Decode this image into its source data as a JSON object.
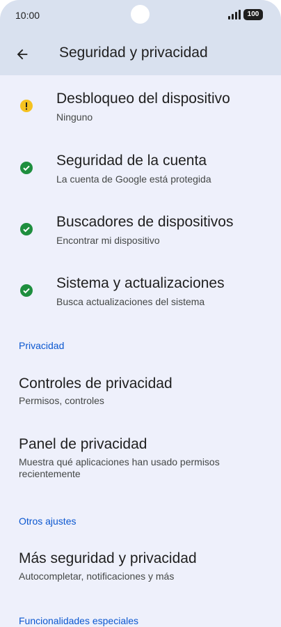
{
  "status_bar": {
    "time": "10:00",
    "battery": "100"
  },
  "app_bar": {
    "title": "Seguridad y privacidad"
  },
  "status_items": [
    {
      "title": "Desbloqueo del dispositivo",
      "subtitle": "Ninguno",
      "state": "warning",
      "icon": "exclamation-icon",
      "color": "#f5c220"
    },
    {
      "title": "Seguridad de la cuenta",
      "subtitle": "La cuenta de Google está protegida",
      "state": "ok",
      "icon": "check-icon",
      "color": "#1e8e3e"
    },
    {
      "title": "Buscadores de dispositivos",
      "subtitle": "Encontrar mi dispositivo",
      "state": "ok",
      "icon": "check-icon",
      "color": "#1e8e3e"
    },
    {
      "title": "Sistema y actualizaciones",
      "subtitle": "Busca actualizaciones del sistema",
      "state": "ok",
      "icon": "check-icon",
      "color": "#1e8e3e"
    }
  ],
  "sections": {
    "privacy": "Privacidad",
    "other": "Otros ajustes",
    "special": "Funcionalidades especiales"
  },
  "privacy_items": [
    {
      "title": "Controles de privacidad",
      "subtitle": "Permisos, controles"
    },
    {
      "title": "Panel de privacidad",
      "subtitle": "Muestra qué aplicaciones han usado permisos recientemente"
    }
  ],
  "other_items": [
    {
      "title": "Más seguridad y privacidad",
      "subtitle": "Autocompletar, notificaciones y más"
    }
  ],
  "colors": {
    "accent": "#0b57d0",
    "header_bg": "#d9e1ef",
    "page_bg": "#eef0fb"
  }
}
